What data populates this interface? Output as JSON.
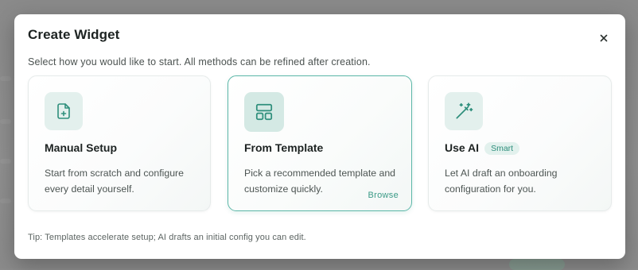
{
  "dialog": {
    "title": "Create Widget",
    "subtitle": "Select how you would like to start. All methods can be refined after creation.",
    "close_icon": "close-icon",
    "footer_tip": "Tip: Templates accelerate setup; AI drafts an initial config you can edit."
  },
  "options": [
    {
      "id": "manual",
      "icon": "file-plus-icon",
      "title": "Manual Setup",
      "description": "Start from scratch and configure every detail yourself.",
      "selected": false
    },
    {
      "id": "template",
      "icon": "layout-template-icon",
      "title": "From Template",
      "description": "Pick a recommended template and customize quickly.",
      "link_label": "Browse",
      "selected": true
    },
    {
      "id": "ai",
      "icon": "magic-wand-icon",
      "title": "Use AI",
      "badge": "Smart",
      "description": "Let AI draft an onboarding configuration for you.",
      "selected": false
    }
  ],
  "colors": {
    "accent": "#3a9a86",
    "accent_border": "#5cb7a8",
    "icon_tile_bg": "#e3f0ed",
    "badge_bg": "#e2f1ed",
    "overlay": "#8d8d8d"
  }
}
